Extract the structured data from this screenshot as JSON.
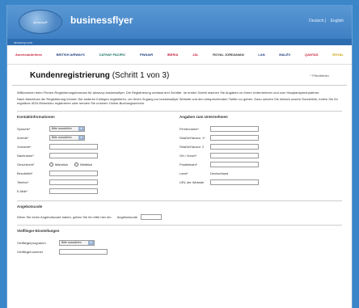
{
  "header": {
    "logo_text": "airsavvy®",
    "brand": "businessflyer",
    "lang": [
      "Deutsch",
      "English"
    ]
  },
  "subbar": {
    "text": "airsavvy.com"
  },
  "airlines": [
    "AmericanAirlines",
    "BRITISH AIRWAYS",
    "CATHAY PACIFIC",
    "FINNAIR",
    "IBERIA",
    "JAL",
    "ROYAL JORDANIAN",
    "LAN",
    "MALÉV",
    "QANTAS",
    "ROYAL"
  ],
  "page_title": "Kundenregistrierung",
  "step": "(Schritt 1 von 3)",
  "required_note": "* Pflichtfelder",
  "intro": [
    "Willkommen beim Firmen-Registrierungsformular für airsavvy businessflyer. Die Registrierung umfasst drei Schritte. Im ersten Schritt machen Sie Angaben zu Ihrem Unternehmen und zum Hauptansprechpartner.",
    "Nach Abschluss der Registrierung können Sie anderen Kollegen registrieren, um Ihnen Zugang zur businessflyer Website und den entsprechenden Tarifen zu geben. Dazu senden Sie einfach unsere Sonderlink, indem Sie Ihr reguläres IATA-Reisebüro registrieren oder senden Sie unseren Online-Buchungsservice."
  ],
  "contact": {
    "title": "Kontaktinformationen",
    "language_label": "Sprache*",
    "language_value": "Bitte auswählen",
    "salutation_label": "Anrede*",
    "salutation_value": "Bitte auswählen",
    "firstname_label": "Vorname*",
    "lastname_label": "Nachname*",
    "gender_label": "Geschlecht*",
    "gender_m": "Männlich",
    "gender_f": "Weiblich",
    "position_label": "Berufstitel*",
    "phone_label": "Telefon*",
    "email_label": "E-Mail*"
  },
  "company": {
    "title": "Angaben zum Unternehmen",
    "name_label": "Firmenname*",
    "street1_label": "Straße/Hausnr. 1*",
    "street2_label": "Straße/Hausnr. 2",
    "city_label": "Ort / Vorort*",
    "zip_label": "Postleitzahl*",
    "country_label": "Land*",
    "country_value": "Deutschland",
    "url_label": "URL der Website"
  },
  "offer": {
    "title": "Angebotscode",
    "text": "Wenn Sie einen Angebotscode haben, geben Sie ihn bitte hier ein.",
    "label": "Angebotscode"
  },
  "ff": {
    "title": "Vielflieger-Einstellungen",
    "program_label": "Vielfliegerprogramm",
    "program_value": "Bitte auswählen",
    "number_label": "Vielfliegernummer"
  },
  "colors": {
    "bg": "#3a86c8",
    "header": "#4a8cd0"
  }
}
